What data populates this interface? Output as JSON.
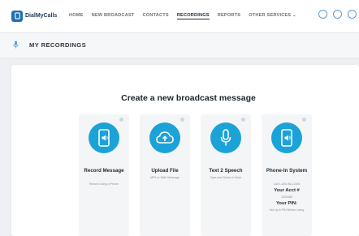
{
  "logo": {
    "text": "DialMyCalls"
  },
  "nav": {
    "items": [
      "HOME",
      "NEW BROADCAST",
      "CONTACTS",
      "RECORDINGS",
      "REPORTS",
      "OTHER SERVICES ⌄"
    ],
    "active": "RECORDINGS"
  },
  "top_icons": [
    "help-icon",
    "chat-icon",
    "account-icon"
  ],
  "section": {
    "title": "MY RECORDINGS"
  },
  "main": {
    "headline": "Create a new broadcast message",
    "options": [
      {
        "icon": "phone-speaker-icon",
        "title": "Record Message",
        "subtitle": "Record Using a Phone"
      },
      {
        "icon": "cloud-upload-icon",
        "title": "Upload File",
        "subtitle": "MP3 or WAV Message"
      },
      {
        "icon": "microphone-icon",
        "title": "Text 2 Speech",
        "subtitle": "Type and Select a Voice"
      },
      {
        "icon": "phone-speaker-icon",
        "title": "Phone-In System",
        "subtitle": "Call 1-800-961-2406",
        "acct_label": "Your Acct #",
        "acct_value": "1020485",
        "pin_label": "Your PIN:",
        "pin_value": "Set Up A PIN Before Using"
      }
    ]
  },
  "colors": {
    "accent": "#1ba3d8",
    "nav_active": "#1d2a38",
    "logo": "#1f6fb4"
  }
}
